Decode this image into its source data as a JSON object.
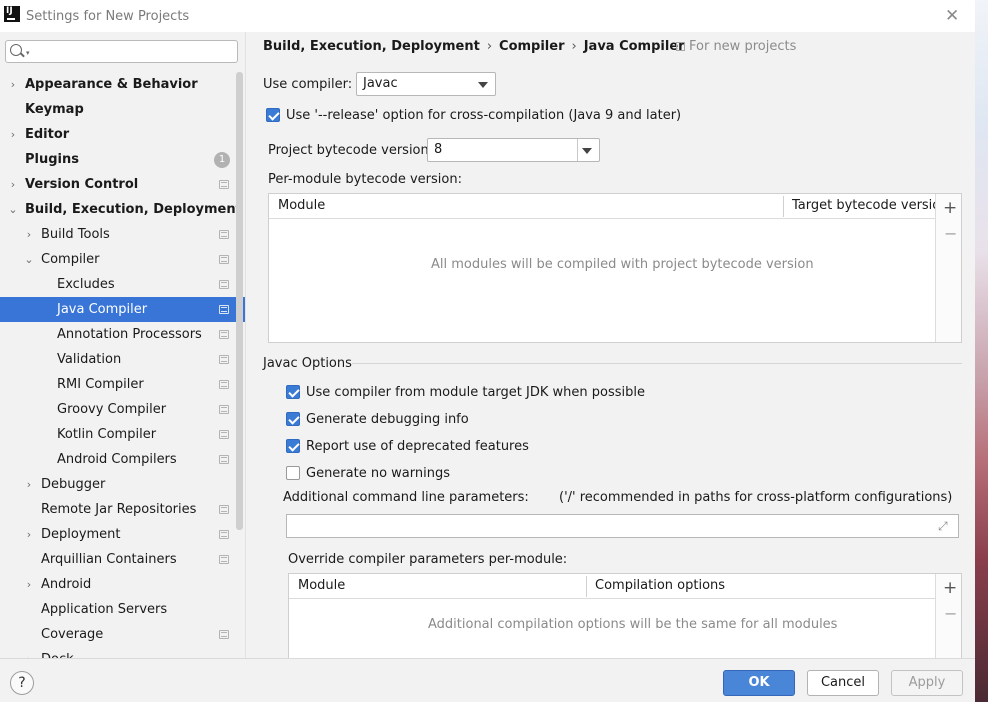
{
  "window": {
    "title": "Settings for New Projects"
  },
  "sidebar": {
    "search_placeholder": "",
    "items": [
      {
        "label": "Appearance & Behavior",
        "bold": true,
        "arrow": "›",
        "depth": 0
      },
      {
        "label": "Keymap",
        "bold": true,
        "arrow": "",
        "depth": 0
      },
      {
        "label": "Editor",
        "bold": true,
        "arrow": "›",
        "depth": 0
      },
      {
        "label": "Plugins",
        "bold": true,
        "arrow": "",
        "depth": 0,
        "badge": "1"
      },
      {
        "label": "Version Control",
        "bold": true,
        "arrow": "›",
        "depth": 0,
        "proj_icon": true
      },
      {
        "label": "Build, Execution, Deployment",
        "bold": true,
        "arrow": "⌄",
        "depth": 0
      },
      {
        "label": "Build Tools",
        "arrow": "›",
        "depth": 1,
        "proj_icon": true
      },
      {
        "label": "Compiler",
        "arrow": "⌄",
        "depth": 1,
        "proj_icon": true
      },
      {
        "label": "Excludes",
        "arrow": "",
        "depth": 2,
        "proj_icon": true
      },
      {
        "label": "Java Compiler",
        "arrow": "",
        "depth": 2,
        "proj_icon": true,
        "selected": true
      },
      {
        "label": "Annotation Processors",
        "arrow": "",
        "depth": 2,
        "proj_icon": true
      },
      {
        "label": "Validation",
        "arrow": "",
        "depth": 2,
        "proj_icon": true
      },
      {
        "label": "RMI Compiler",
        "arrow": "",
        "depth": 2,
        "proj_icon": true
      },
      {
        "label": "Groovy Compiler",
        "arrow": "",
        "depth": 2,
        "proj_icon": true
      },
      {
        "label": "Kotlin Compiler",
        "arrow": "",
        "depth": 2,
        "proj_icon": true
      },
      {
        "label": "Android Compilers",
        "arrow": "",
        "depth": 2,
        "proj_icon": true
      },
      {
        "label": "Debugger",
        "arrow": "›",
        "depth": 1
      },
      {
        "label": "Remote Jar Repositories",
        "arrow": "",
        "depth": 1,
        "proj_icon": true
      },
      {
        "label": "Deployment",
        "arrow": "›",
        "depth": 1,
        "proj_icon": true
      },
      {
        "label": "Arquillian Containers",
        "arrow": "",
        "depth": 1,
        "proj_icon": true
      },
      {
        "label": "Android",
        "arrow": "›",
        "depth": 1
      },
      {
        "label": "Application Servers",
        "arrow": "",
        "depth": 1
      },
      {
        "label": "Coverage",
        "arrow": "",
        "depth": 1,
        "proj_icon": true
      },
      {
        "label": "Dock",
        "arrow": "›",
        "depth": 1
      }
    ]
  },
  "breadcrumb": [
    "Build, Execution, Deployment",
    "Compiler",
    "Java Compiler"
  ],
  "scope_label": "For new projects",
  "main": {
    "use_compiler_label": "Use compiler:",
    "use_compiler_value": "Javac",
    "release_option_label": "Use '--release' option for cross-compilation (Java 9 and later)",
    "release_option_checked": true,
    "bytecode_label": "Project bytecode version:",
    "bytecode_value": "8",
    "per_module_label": "Per-module bytecode version:",
    "per_module_table": {
      "columns": [
        "Module",
        "Target bytecode version"
      ],
      "empty_text": "All modules will be compiled with project bytecode version"
    },
    "javac_options_title": "Javac Options",
    "javac_options": [
      {
        "label": "Use compiler from module target JDK when possible",
        "checked": true
      },
      {
        "label": "Generate debugging info",
        "checked": true
      },
      {
        "label": "Report use of deprecated features",
        "checked": true
      },
      {
        "label": "Generate no warnings",
        "checked": false
      }
    ],
    "additional_params_label": "Additional command line parameters:",
    "additional_params_hint": "('/' recommended in paths for cross-platform configurations)",
    "additional_params_value": "",
    "override_label": "Override compiler parameters per-module:",
    "override_table": {
      "columns": [
        "Module",
        "Compilation options"
      ],
      "empty_text": "Additional compilation options will be the same for all modules"
    }
  },
  "buttons": {
    "help": "?",
    "ok": "OK",
    "cancel": "Cancel",
    "apply": "Apply"
  },
  "colors": {
    "selection": "#3875d7",
    "primary_button": "#4a86d8"
  }
}
